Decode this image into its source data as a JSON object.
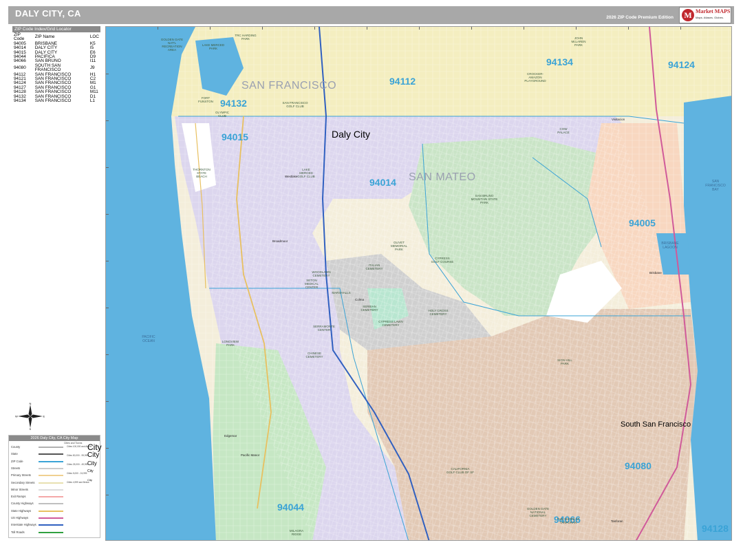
{
  "header": {
    "title": "DALY CITY, CA",
    "edition": "2026 ZIP Code Premium Edition"
  },
  "logo": {
    "letter": "M",
    "brand": "Market MAPS",
    "tagline": "Maps. Atlases. Globes."
  },
  "locator": {
    "title": "ZIP Code Index/Grid Locator",
    "headers": [
      "ZIP Code",
      "ZIP Name",
      "LOC"
    ],
    "rows": [
      [
        "94005",
        "BRISBANE",
        "K5"
      ],
      [
        "94014",
        "DALY CITY",
        "I5"
      ],
      [
        "94015",
        "DALY CITY",
        "E6"
      ],
      [
        "94044",
        "PACIFICA",
        "D9"
      ],
      [
        "94066",
        "SAN BRUNO",
        "I11"
      ],
      [
        "94080",
        "SOUTH SAN FRANCISCO",
        "J9"
      ],
      [
        "94112",
        "SAN FRANCISCO",
        "H1"
      ],
      [
        "94121",
        "SAN FRANCISCO",
        "C2"
      ],
      [
        "94124",
        "SAN FRANCISCO",
        "M1"
      ],
      [
        "94127",
        "SAN FRANCISCO",
        "G1"
      ],
      [
        "94128",
        "SAN FRANCISCO",
        "M11"
      ],
      [
        "94132",
        "SAN FRANCISCO",
        "D1"
      ],
      [
        "94134",
        "SAN FRANCISCO",
        "L1"
      ]
    ]
  },
  "compass": {
    "n": "N",
    "s": "S",
    "e": "E",
    "w": "W"
  },
  "legend": {
    "title": "2026 Daly City, CA City Map",
    "col_header": "Cities and Towns",
    "rows": [
      {
        "label": "County",
        "color": "#b0b0b0"
      },
      {
        "label": "State",
        "color": "#555555"
      },
      {
        "label": "ZIP Code",
        "color": "#3aa3d6"
      },
      {
        "label": "Streets",
        "color": "#cccccc"
      },
      {
        "label": "Primary Streets",
        "color": "#f0d090"
      },
      {
        "label": "Secondary Streets",
        "color": "#e8e0b0"
      },
      {
        "label": "Minor Streets",
        "color": "#dddddd"
      },
      {
        "label": "Exit Ramps",
        "color": "#f4a8a8"
      },
      {
        "label": "County Highways",
        "color": "#c0c0c0"
      },
      {
        "label": "State Highways",
        "color": "#e8c060"
      },
      {
        "label": "US Highways",
        "color": "#d05a9a"
      },
      {
        "label": "Interstate Highways",
        "color": "#3060c0"
      },
      {
        "label": "Toll Roads",
        "color": "#30a040"
      }
    ],
    "cities": [
      {
        "pop": "Cities 100,000 and Above",
        "name": "City",
        "size": "large"
      },
      {
        "pop": "Cities 50,000 - 99,999",
        "name": "City",
        "size": "medium"
      },
      {
        "pop": "Cities 25,000 - 49,999",
        "name": "City",
        "size": "small"
      },
      {
        "pop": "Cities 5,000 - 24,999",
        "name": "City",
        "size": "xsmall"
      },
      {
        "pop": "Cities 4,999 and Below",
        "name": "City",
        "size": "tiny"
      }
    ]
  },
  "map": {
    "colors": {
      "ocean": "#5fb3e0",
      "sf": "#f4eec0",
      "daly": "#dcd6ee",
      "pacifica": "#c6e7c4",
      "ssf": "#e2c9b5",
      "brisbane": "#f8d7c0",
      "mountain": "#c9e4c6",
      "cemetery": "#cfcfcf",
      "zip_line": "#3aa3d6",
      "us_highway": "#d05a9a",
      "interstate": "#3060c0"
    },
    "zips": [
      "94015",
      "94014",
      "94112",
      "94134",
      "94124",
      "94132",
      "94005",
      "94080",
      "94044",
      "94066",
      "94128"
    ],
    "city_regions": [
      "SAN FRANCISCO",
      "SAN MATEO"
    ],
    "cities": [
      "Daly City",
      "South San Francisco"
    ],
    "water": [
      "PACIFIC OCEAN",
      "SAN FRANCISCO BAY",
      "BRISBANE LAGOON"
    ],
    "parks": [
      "GOLDEN GATE NAT'L RECREATION AREA",
      "LAKE MERCED PARK",
      "TRC HARDING PARK",
      "SAN FRANCISCO GOLF CLUB",
      "OLYMPIC CLUB",
      "FORT FUNSTON",
      "THORNTON STATE BEACH",
      "LAKE MERCED GOLF CLUB",
      "SAN BRUNO MOUNTAIN STATE PARK",
      "OLIVET MEMORIAL PARK",
      "CYPRESS GOLF COURSE",
      "WOODLAWN CEMETERY",
      "ITALIAN CEMETERY",
      "CYPRESS LAWN CEMETERY",
      "HOLY CROSS CEMETERY",
      "SERBIAN CEMETERY",
      "CHINESE CEMETERY",
      "LONGVIEW PARK",
      "SIGN HILL PARK",
      "CALIFORNIA GOLF CLUB OF SF",
      "GOLDEN GATE NATIONAL CEMETERY",
      "MILAGRA RIDGE",
      "JOHN McLAREN PARK",
      "CROCKER-AMAZON PLAYGROUND",
      "COW PALACE",
      "MARSHALLS",
      "SERRAMONTE CENTER",
      "THE SHOPS AT TANFORAN",
      "SETON MEDICAL CENTER"
    ],
    "towns": [
      "Broadmoor",
      "Westlake",
      "Colma",
      "Brisbane",
      "Edgemar",
      "Pacific Manor",
      "Tanforan",
      "Visitacion"
    ]
  }
}
